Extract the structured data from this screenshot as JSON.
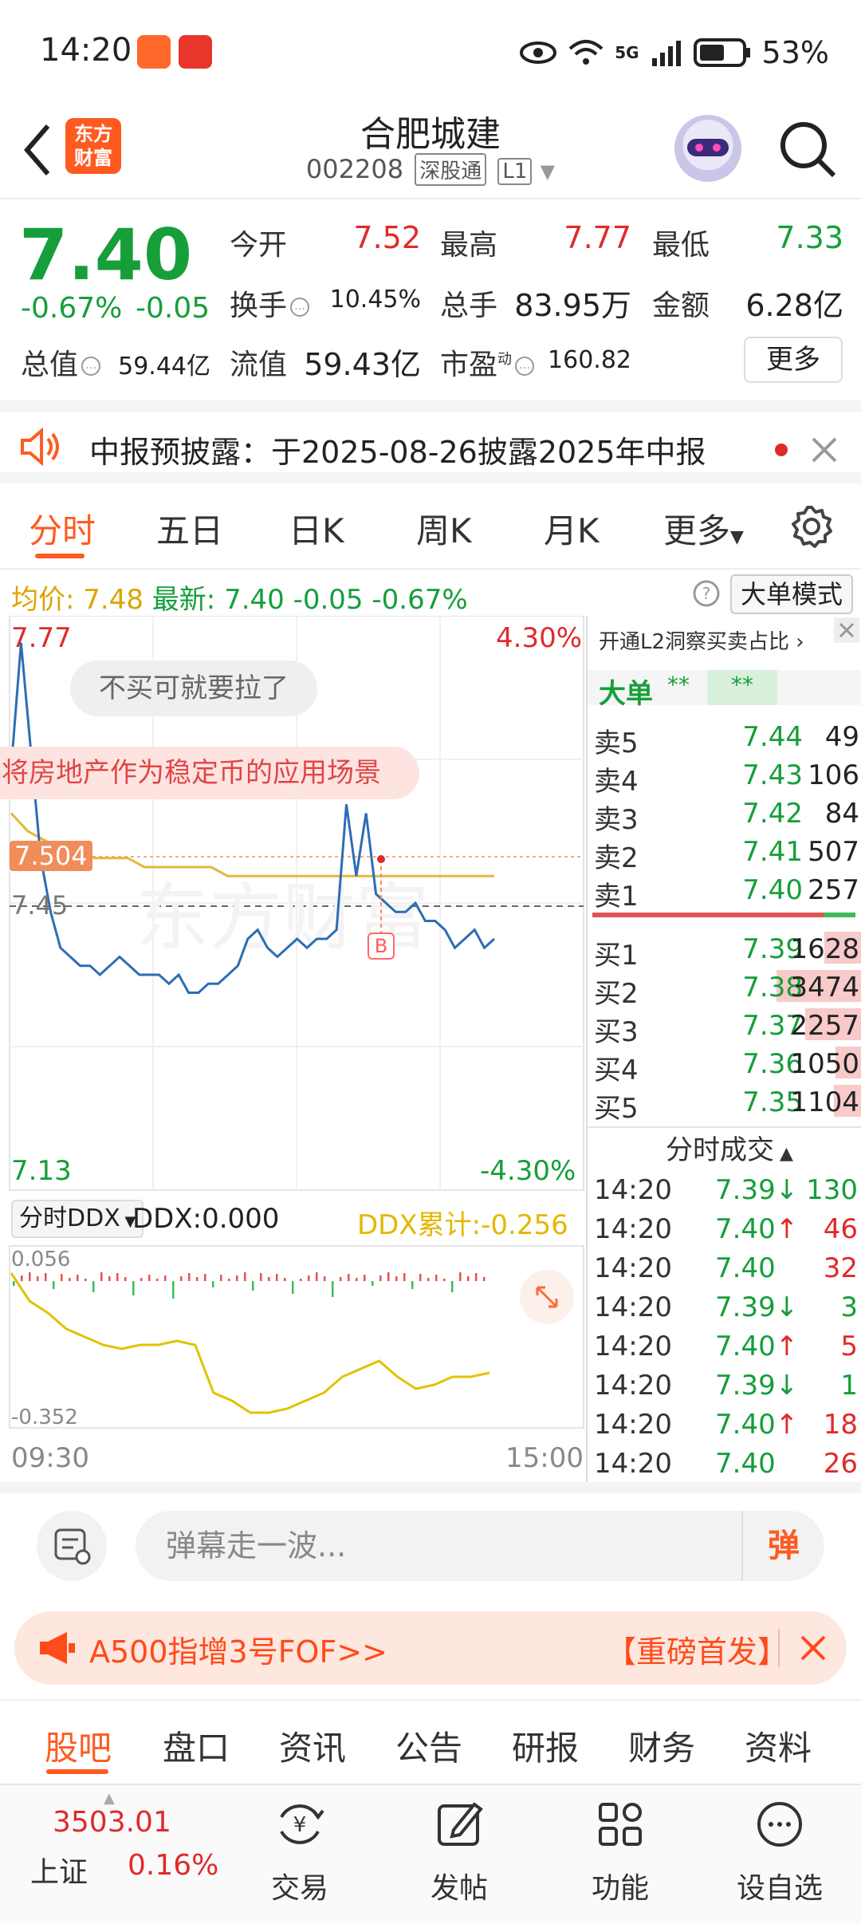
{
  "status_bar": {
    "time": "14:20",
    "battery": "53%",
    "network": "5G"
  },
  "header": {
    "stock_name": "合肥城建",
    "stock_code": "002208",
    "tag_connect": "深股通",
    "tag_level": "L1",
    "brand": "东方\n财富"
  },
  "quote": {
    "price": "7.40",
    "pct_change": "-0.67%",
    "abs_change": "-0.05",
    "open_label": "今开",
    "open": "7.52",
    "high_label": "最高",
    "high": "7.77",
    "low_label": "最低",
    "low": "7.33",
    "turnover_label": "换手",
    "turnover": "10.45%",
    "volume_label": "总手",
    "volume": "83.95万",
    "amount_label": "金额",
    "amount": "6.28亿",
    "mktcap_label": "总值",
    "mktcap": "59.44亿",
    "float_label": "流值",
    "float_cap": "59.43亿",
    "pe_label": "市盈",
    "pe_sup": "动",
    "pe": "160.82",
    "more_label": "更多"
  },
  "notice": {
    "text": "中报预披露：于2025-08-26披露2025年中报"
  },
  "chart_tabs": [
    "分时",
    "五日",
    "日K",
    "周K",
    "月K",
    "更多"
  ],
  "avg_row": {
    "avg_label": "均价:",
    "avg_value": "7.48",
    "latest_label": "最新:",
    "latest_value": "7.40",
    "latest_change": "-0.05",
    "latest_pct": "-0.67%",
    "big_order_mode": "大单模式"
  },
  "chart": {
    "y_top": "7.77",
    "y_bottom": "7.13",
    "pct_top": "4.30%",
    "pct_bottom": "-4.30%",
    "marker_price": "7.504",
    "ref_price": "7.45",
    "bubble_1": "不买可就要拉了",
    "bubble_2": "将房地产作为稳定币的应用场景",
    "buy_marker": "B",
    "ddx_select": "分时DDX",
    "ddx_value": "DDX:0.000",
    "ddx_cum": "DDX累计:-0.256",
    "ddx_top": "0.056",
    "ddx_bottom": "-0.352",
    "time_start": "09:30",
    "time_end": "15:00"
  },
  "chart_data": {
    "type": "line",
    "title": "",
    "series": [
      {
        "name": "",
        "values": [
          7.6,
          7.74,
          7.62,
          7.5,
          7.44,
          7.4,
          7.39,
          7.38,
          7.38,
          7.37,
          7.38,
          7.39,
          7.38,
          7.37,
          7.37,
          7.37,
          7.36,
          7.37,
          7.35,
          7.35,
          7.36,
          7.36,
          7.37,
          7.38,
          7.41,
          7.42,
          7.4,
          7.39,
          7.4,
          7.41,
          7.4,
          7.41,
          7.41,
          7.42,
          7.56,
          7.48,
          7.55,
          7.46,
          7.45,
          7.44,
          7.44,
          7.45,
          7.43,
          7.43,
          7.42,
          7.4,
          7.41,
          7.42,
          7.4,
          7.41
        ]
      },
      {
        "name": "均价",
        "values": [
          7.55,
          7.53,
          7.52,
          7.51,
          7.51,
          7.5,
          7.5,
          7.5,
          7.49,
          7.49,
          7.49,
          7.49,
          7.49,
          7.48,
          7.48,
          7.48,
          7.48,
          7.48,
          7.48,
          7.48,
          7.48,
          7.48,
          7.48,
          7.48,
          7.48,
          7.48,
          7.48,
          7.48,
          7.48,
          7.48
        ]
      }
    ],
    "ylim": [
      7.13,
      7.77
    ],
    "x_start": "09:30",
    "x_end": "15:00"
  },
  "orderbook": {
    "header": "开通L2洞察买卖占比",
    "big_order_label": "大单",
    "big_order_v1": "**",
    "big_order_v2": "**",
    "asks": [
      {
        "label": "卖5",
        "price": "7.44",
        "vol": "49"
      },
      {
        "label": "卖4",
        "price": "7.43",
        "vol": "106"
      },
      {
        "label": "卖3",
        "price": "7.42",
        "vol": "84"
      },
      {
        "label": "卖2",
        "price": "7.41",
        "vol": "507"
      },
      {
        "label": "卖1",
        "price": "7.40",
        "vol": "257"
      }
    ],
    "bids": [
      {
        "label": "买1",
        "price": "7.39",
        "vol": "1628",
        "bar": 0.4
      },
      {
        "label": "买2",
        "price": "7.38",
        "vol": "3474",
        "bar": 0.9
      },
      {
        "label": "买3",
        "price": "7.37",
        "vol": "2257",
        "bar": 0.6
      },
      {
        "label": "买4",
        "price": "7.36",
        "vol": "1050",
        "bar": 0.28
      },
      {
        "label": "买5",
        "price": "7.35",
        "vol": "1104",
        "bar": 0.3
      }
    ],
    "ticks_header": "分时成交",
    "ticks": [
      {
        "time": "14:20",
        "price": "7.39",
        "dir": "↓",
        "vol": "130",
        "side": "sell"
      },
      {
        "time": "14:20",
        "price": "7.40",
        "dir": "↑",
        "vol": "46",
        "side": "buy"
      },
      {
        "time": "14:20",
        "price": "7.40",
        "dir": "",
        "vol": "32",
        "side": "buy"
      },
      {
        "time": "14:20",
        "price": "7.39",
        "dir": "↓",
        "vol": "3",
        "side": "sell"
      },
      {
        "time": "14:20",
        "price": "7.40",
        "dir": "↑",
        "vol": "5",
        "side": "buy"
      },
      {
        "time": "14:20",
        "price": "7.39",
        "dir": "↓",
        "vol": "1",
        "side": "sell"
      },
      {
        "time": "14:20",
        "price": "7.40",
        "dir": "↑",
        "vol": "18",
        "side": "buy"
      },
      {
        "time": "14:20",
        "price": "7.40",
        "dir": "",
        "vol": "26",
        "side": "buy"
      }
    ]
  },
  "comment": {
    "placeholder": "弹幕走一波...",
    "danmu_label": "弹"
  },
  "promo": {
    "text": "A500指增3号FOF>>",
    "tag": "【重磅首发】"
  },
  "bottom_tabs": [
    "股吧",
    "盘口",
    "资讯",
    "公告",
    "研报",
    "财务",
    "资料"
  ],
  "nav": {
    "index_value": "3503.01",
    "index_name": "上证",
    "index_pct": "0.16%",
    "items": [
      "交易",
      "发帖",
      "功能",
      "设自选"
    ]
  }
}
